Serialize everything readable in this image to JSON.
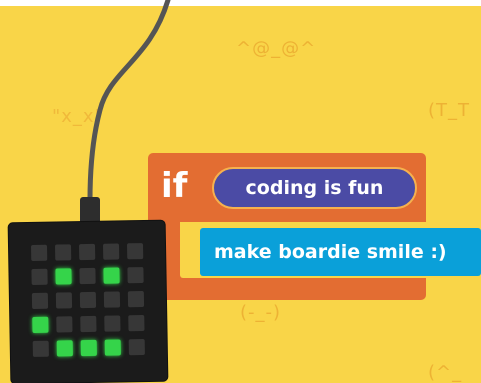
{
  "emoticons": [
    "^@_@^",
    "\"x_x\"",
    "(T_T",
    "(-_-)",
    "(^_"
  ],
  "code_block": {
    "keyword": "if",
    "condition": "coding is fun",
    "action": "make boardie smile :)"
  },
  "colors": {
    "background": "#F9D548",
    "if_block": "#E36D32",
    "condition_pill": "#4B4BA5",
    "action_block": "#0AA0D9",
    "led_on": "#35D44A",
    "led_off": "#373737",
    "board": "#1B1B1B"
  },
  "board": {
    "led_grid_size": 5,
    "lit_leds": [
      [
        1,
        1
      ],
      [
        1,
        3
      ],
      [
        3,
        0
      ],
      [
        4,
        1
      ],
      [
        4,
        2
      ],
      [
        4,
        3
      ]
    ]
  }
}
